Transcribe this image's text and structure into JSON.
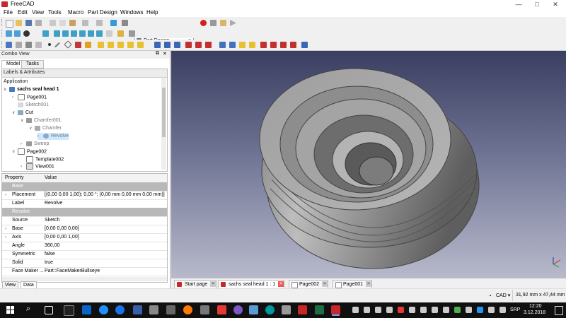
{
  "window": {
    "title": "FreeCAD",
    "minimize": "—",
    "maximize": "□",
    "close": "✕"
  },
  "menu": [
    "File",
    "Edit",
    "View",
    "Tools",
    "Macro",
    "Part Design",
    "Windows",
    "Help"
  ],
  "workbench": {
    "selected": "Part Design"
  },
  "combo": {
    "title": "Combo View",
    "tabs": [
      "Model",
      "Tasks"
    ],
    "section": "Labels & Attributes",
    "application": "Application",
    "tree": [
      {
        "label": "sachs seal head 1"
      },
      {
        "label": "Page001"
      },
      {
        "label": "Sketch001"
      },
      {
        "label": "Cut"
      },
      {
        "label": "Chamfer001"
      },
      {
        "label": "Chamfer"
      },
      {
        "label": "Revolve"
      },
      {
        "label": "Sweep"
      },
      {
        "label": "Page002"
      },
      {
        "label": "Template002"
      },
      {
        "label": "View001"
      }
    ]
  },
  "properties": {
    "header": {
      "property": "Property",
      "value": "Value"
    },
    "rows": [
      {
        "name": "Base",
        "value": ""
      },
      {
        "name": "Placement",
        "value": "[(0,00 0,00 1,00); 0,00 °; (0,00 mm  0,00 mm  0,00 mm)]"
      },
      {
        "name": "Label",
        "value": "Revolve"
      },
      {
        "name": "Revolve",
        "value": ""
      },
      {
        "name": "Source",
        "value": "Sketch"
      },
      {
        "name": "Base",
        "value": "[0,00 0,00 0,00]"
      },
      {
        "name": "Axis",
        "value": "[0,00 0,00 1,00]"
      },
      {
        "name": "Angle",
        "value": "360,00"
      },
      {
        "name": "Symmetric",
        "value": "false"
      },
      {
        "name": "Solid",
        "value": "true"
      },
      {
        "name": "Face Maker ...",
        "value": "Part::FaceMakerBullseye"
      }
    ],
    "tabs": [
      "View",
      "Data"
    ]
  },
  "doc_tabs": [
    {
      "label": "Start page"
    },
    {
      "label": "sachs seal head 1 : 1"
    },
    {
      "label": "Page002"
    },
    {
      "label": "Page001"
    }
  ],
  "status": {
    "nav": "CAD",
    "dims": "31,92 mm x 47,44 mm"
  },
  "taskbar": {
    "lang": "SRP",
    "time": "12:20",
    "date": "3.12.2018"
  },
  "colors": {
    "accent": "#c7262d",
    "selection": "#cde8ff",
    "group_row": "#b8b8b8"
  }
}
